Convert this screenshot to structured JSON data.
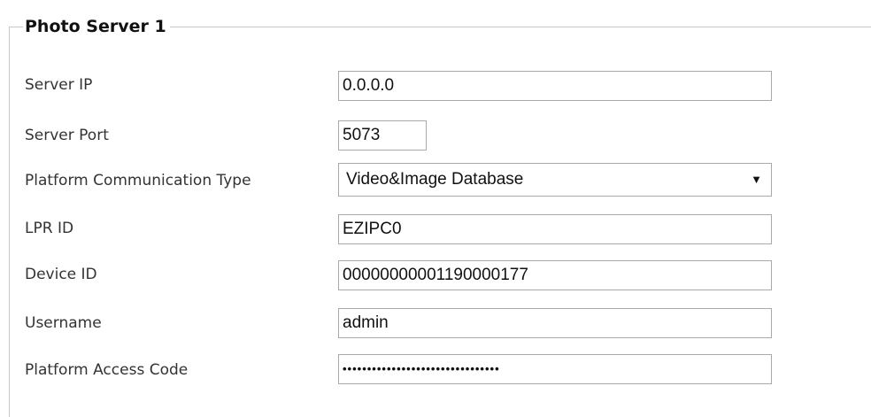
{
  "section": {
    "title": "Photo Server 1"
  },
  "fields": {
    "server_ip": {
      "label": "Server IP",
      "value": "0.0.0.0"
    },
    "server_port": {
      "label": "Server Port",
      "value": "5073"
    },
    "platform_communication_type": {
      "label": "Platform Communication Type",
      "value": "Video&Image Database",
      "arrow": "▼",
      "icon": "dropdown-arrow-icon"
    },
    "lpr_id": {
      "label": "LPR ID",
      "value": "EZIPC0"
    },
    "device_id": {
      "label": "Device ID",
      "value": "00000000001190000177"
    },
    "username": {
      "label": "Username",
      "value": "admin"
    },
    "platform_access_code": {
      "label": "Platform Access Code",
      "value": "••••••••••••••••••••••••••••••••"
    }
  }
}
